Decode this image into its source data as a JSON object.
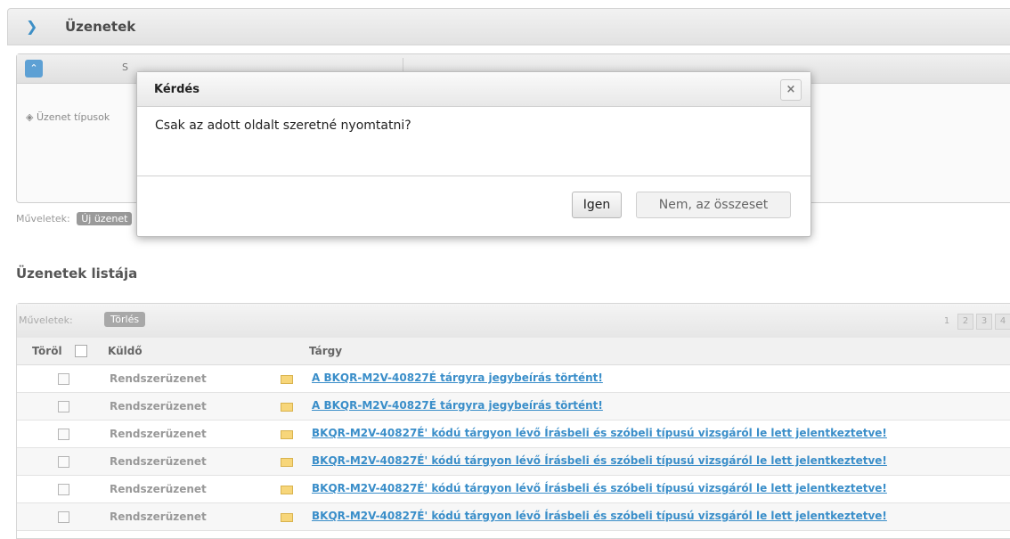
{
  "header": {
    "title": "Üzenetek"
  },
  "search": {
    "col1_label": "S",
    "col2_label": "",
    "type_label": "Üzenet típusok"
  },
  "ops": {
    "label": "Műveletek:",
    "new_button": "Új üzenet"
  },
  "list": {
    "title": "Üzenetek listája",
    "toolbar_label": "Műveletek:",
    "delete_button": "Törlés",
    "pages": [
      "1",
      "2",
      "3",
      "4"
    ],
    "columns": {
      "delete": "Töröl",
      "sender": "Küldő",
      "subject": "Tárgy"
    },
    "rows": [
      {
        "sender": "Rendszerüzenet",
        "subject": "A BKQR-M2V-40827É tárgyra jegybeírás történt!"
      },
      {
        "sender": "Rendszerüzenet",
        "subject": "A BKQR-M2V-40827É tárgyra jegybeírás történt!"
      },
      {
        "sender": "Rendszerüzenet",
        "subject": "BKQR-M2V-40827É' kódú tárgyon lévő Írásbeli és szóbeli típusú vizsgáról le lett jelentkeztetve!"
      },
      {
        "sender": "Rendszerüzenet",
        "subject": "BKQR-M2V-40827É' kódú tárgyon lévő Írásbeli és szóbeli típusú vizsgáról le lett jelentkeztetve!"
      },
      {
        "sender": "Rendszerüzenet",
        "subject": "BKQR-M2V-40827É' kódú tárgyon lévő Írásbeli és szóbeli típusú vizsgáról le lett jelentkeztetve!"
      },
      {
        "sender": "Rendszerüzenet",
        "subject": "BKQR-M2V-40827É' kódú tárgyon lévő Írásbeli és szóbeli típusú vizsgáról le lett jelentkeztetve!"
      }
    ]
  },
  "dialog": {
    "title": "Kérdés",
    "close_icon": "×",
    "question": "Csak az adott oldalt szeretné nyomtatni?",
    "yes_button": "Igen",
    "no_button": "Nem, az összeset"
  },
  "colors": {
    "accent": "#3a8ec9",
    "collapse": "#5da0d4"
  }
}
